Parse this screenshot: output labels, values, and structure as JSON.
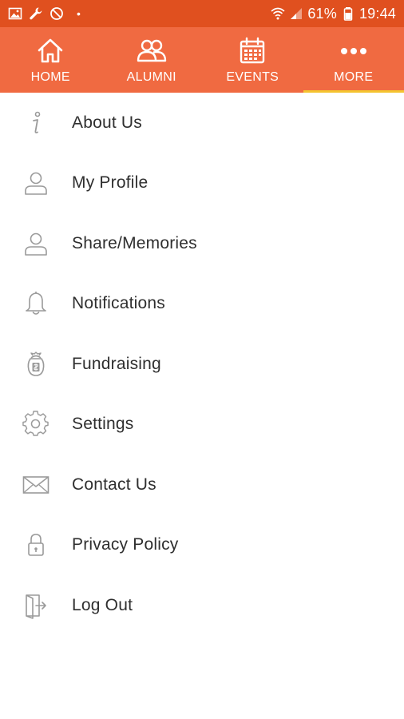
{
  "status_bar": {
    "battery": "61%",
    "time": "19:44",
    "icons": [
      "image-icon",
      "wrench-icon",
      "no-disturb-icon",
      "wifi-icon",
      "signal-icon",
      "battery-icon"
    ],
    "dot": "•"
  },
  "nav": {
    "background": "#f06a41",
    "active_indicator": "#f4c430",
    "tabs": [
      {
        "label": "HOME",
        "icon": "home-icon"
      },
      {
        "label": "ALUMNI",
        "icon": "alumni-icon"
      },
      {
        "label": "EVENTS",
        "icon": "calendar-icon"
      },
      {
        "label": "MORE",
        "icon": "more-icon",
        "active": true
      }
    ]
  },
  "menu": {
    "items": [
      {
        "label": "About Us",
        "icon": "info-icon"
      },
      {
        "label": "My Profile",
        "icon": "profile-icon"
      },
      {
        "label": "Share/Memories",
        "icon": "memories-icon"
      },
      {
        "label": "Notifications",
        "icon": "bell-icon"
      },
      {
        "label": "Fundraising",
        "icon": "fundraising-icon"
      },
      {
        "label": "Settings",
        "icon": "gear-icon"
      },
      {
        "label": "Contact Us",
        "icon": "envelope-icon"
      },
      {
        "label": "Privacy Policy",
        "icon": "lock-icon"
      },
      {
        "label": "Log Out",
        "icon": "logout-icon"
      }
    ]
  }
}
